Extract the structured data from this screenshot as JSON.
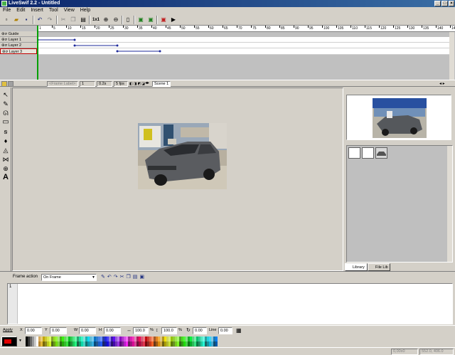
{
  "window": {
    "title": "LiveSwif 2.2 - Untitled"
  },
  "menu": [
    "File",
    "Edit",
    "Insert",
    "Tool",
    "View",
    "Help"
  ],
  "toolbar": {
    "zoom_label": "1x1",
    "icons": [
      "new-icon",
      "open-icon",
      "save-icon",
      "undo-icon",
      "redo-icon",
      "cut-icon",
      "copy-icon",
      "paste-icon",
      "zoom-label",
      "zoom-in-icon",
      "zoom-out-icon",
      "page-icon",
      "import-icon",
      "export-icon",
      "publish-icon",
      "test-movie-icon",
      "play-icon"
    ]
  },
  "timeline": {
    "ruler_labels": [
      "1",
      "5",
      "10",
      "15",
      "20",
      "25",
      "30",
      "35",
      "40",
      "45",
      "50",
      "55",
      "60",
      "65",
      "70",
      "75",
      "80",
      "85",
      "90",
      "95",
      "100",
      "105",
      "110",
      "115",
      "120",
      "125",
      "130",
      "135",
      "140",
      "145"
    ],
    "layers": [
      {
        "name": "Guide"
      },
      {
        "name": "Layer 1"
      },
      {
        "name": "Layer 2"
      },
      {
        "name": "Layer 3",
        "selected": true
      }
    ]
  },
  "timeline_status": {
    "frame_label": "<Frame Label>",
    "frame_number": "1",
    "time": "0.2s",
    "fps": "5 fps",
    "scene": "Scene 1"
  },
  "tools": [
    "arrow-tool-icon",
    "pen-tool-icon",
    "brush-tool-icon",
    "rectangle-tool-icon",
    "ellipse-tool-icon",
    "paint-bucket-icon",
    "ink-bottle-icon",
    "shape-tool-icon",
    "zoom-tool-icon",
    "text-tool-icon"
  ],
  "text_tool_glyph": "A",
  "library": {
    "tabs": [
      "Library",
      "File Lib"
    ]
  },
  "frame_action": {
    "label": "Frame action",
    "event": "On Frame",
    "line_number": "1"
  },
  "properties": {
    "apply_label": "Apply",
    "x_label": "X",
    "x_value": "0.00",
    "y_label": "Y",
    "y_value": "0.00",
    "w_label": "W",
    "w_value": "0.00",
    "h_label": "H",
    "h_value": "0.00",
    "sx_value": "100.0",
    "sx_unit": "%",
    "sy_value": "100.0",
    "sy_unit": "%",
    "rot_value": "0.00",
    "line_label": "Line",
    "line_value": "0.00"
  },
  "status": {
    "left": "0,00x0",
    "right": "552.0, 406.0"
  },
  "colors": {
    "title_bar": "#0a246a",
    "keyframe_line": "#1e2a9a",
    "layer_selected_border": "#c00000"
  }
}
